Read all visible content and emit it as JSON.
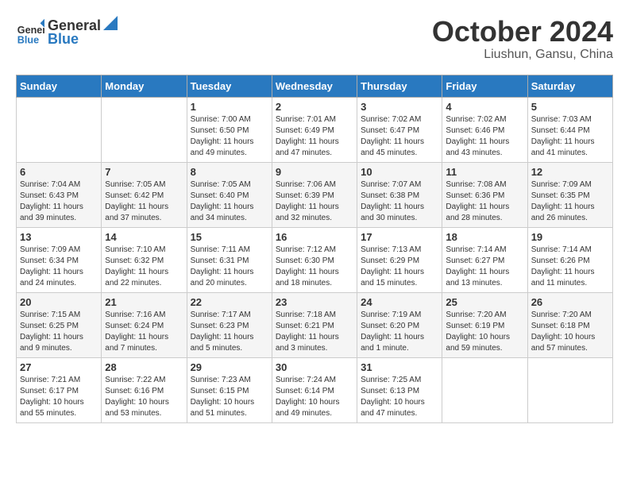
{
  "header": {
    "logo_line1": "General",
    "logo_line2": "Blue",
    "month": "October 2024",
    "location": "Liushun, Gansu, China"
  },
  "days_of_week": [
    "Sunday",
    "Monday",
    "Tuesday",
    "Wednesday",
    "Thursday",
    "Friday",
    "Saturday"
  ],
  "weeks": [
    [
      {
        "day": "",
        "data": ""
      },
      {
        "day": "",
        "data": ""
      },
      {
        "day": "1",
        "data": "Sunrise: 7:00 AM\nSunset: 6:50 PM\nDaylight: 11 hours and 49 minutes."
      },
      {
        "day": "2",
        "data": "Sunrise: 7:01 AM\nSunset: 6:49 PM\nDaylight: 11 hours and 47 minutes."
      },
      {
        "day": "3",
        "data": "Sunrise: 7:02 AM\nSunset: 6:47 PM\nDaylight: 11 hours and 45 minutes."
      },
      {
        "day": "4",
        "data": "Sunrise: 7:02 AM\nSunset: 6:46 PM\nDaylight: 11 hours and 43 minutes."
      },
      {
        "day": "5",
        "data": "Sunrise: 7:03 AM\nSunset: 6:44 PM\nDaylight: 11 hours and 41 minutes."
      }
    ],
    [
      {
        "day": "6",
        "data": "Sunrise: 7:04 AM\nSunset: 6:43 PM\nDaylight: 11 hours and 39 minutes."
      },
      {
        "day": "7",
        "data": "Sunrise: 7:05 AM\nSunset: 6:42 PM\nDaylight: 11 hours and 37 minutes."
      },
      {
        "day": "8",
        "data": "Sunrise: 7:05 AM\nSunset: 6:40 PM\nDaylight: 11 hours and 34 minutes."
      },
      {
        "day": "9",
        "data": "Sunrise: 7:06 AM\nSunset: 6:39 PM\nDaylight: 11 hours and 32 minutes."
      },
      {
        "day": "10",
        "data": "Sunrise: 7:07 AM\nSunset: 6:38 PM\nDaylight: 11 hours and 30 minutes."
      },
      {
        "day": "11",
        "data": "Sunrise: 7:08 AM\nSunset: 6:36 PM\nDaylight: 11 hours and 28 minutes."
      },
      {
        "day": "12",
        "data": "Sunrise: 7:09 AM\nSunset: 6:35 PM\nDaylight: 11 hours and 26 minutes."
      }
    ],
    [
      {
        "day": "13",
        "data": "Sunrise: 7:09 AM\nSunset: 6:34 PM\nDaylight: 11 hours and 24 minutes."
      },
      {
        "day": "14",
        "data": "Sunrise: 7:10 AM\nSunset: 6:32 PM\nDaylight: 11 hours and 22 minutes."
      },
      {
        "day": "15",
        "data": "Sunrise: 7:11 AM\nSunset: 6:31 PM\nDaylight: 11 hours and 20 minutes."
      },
      {
        "day": "16",
        "data": "Sunrise: 7:12 AM\nSunset: 6:30 PM\nDaylight: 11 hours and 18 minutes."
      },
      {
        "day": "17",
        "data": "Sunrise: 7:13 AM\nSunset: 6:29 PM\nDaylight: 11 hours and 15 minutes."
      },
      {
        "day": "18",
        "data": "Sunrise: 7:14 AM\nSunset: 6:27 PM\nDaylight: 11 hours and 13 minutes."
      },
      {
        "day": "19",
        "data": "Sunrise: 7:14 AM\nSunset: 6:26 PM\nDaylight: 11 hours and 11 minutes."
      }
    ],
    [
      {
        "day": "20",
        "data": "Sunrise: 7:15 AM\nSunset: 6:25 PM\nDaylight: 11 hours and 9 minutes."
      },
      {
        "day": "21",
        "data": "Sunrise: 7:16 AM\nSunset: 6:24 PM\nDaylight: 11 hours and 7 minutes."
      },
      {
        "day": "22",
        "data": "Sunrise: 7:17 AM\nSunset: 6:23 PM\nDaylight: 11 hours and 5 minutes."
      },
      {
        "day": "23",
        "data": "Sunrise: 7:18 AM\nSunset: 6:21 PM\nDaylight: 11 hours and 3 minutes."
      },
      {
        "day": "24",
        "data": "Sunrise: 7:19 AM\nSunset: 6:20 PM\nDaylight: 11 hours and 1 minute."
      },
      {
        "day": "25",
        "data": "Sunrise: 7:20 AM\nSunset: 6:19 PM\nDaylight: 10 hours and 59 minutes."
      },
      {
        "day": "26",
        "data": "Sunrise: 7:20 AM\nSunset: 6:18 PM\nDaylight: 10 hours and 57 minutes."
      }
    ],
    [
      {
        "day": "27",
        "data": "Sunrise: 7:21 AM\nSunset: 6:17 PM\nDaylight: 10 hours and 55 minutes."
      },
      {
        "day": "28",
        "data": "Sunrise: 7:22 AM\nSunset: 6:16 PM\nDaylight: 10 hours and 53 minutes."
      },
      {
        "day": "29",
        "data": "Sunrise: 7:23 AM\nSunset: 6:15 PM\nDaylight: 10 hours and 51 minutes."
      },
      {
        "day": "30",
        "data": "Sunrise: 7:24 AM\nSunset: 6:14 PM\nDaylight: 10 hours and 49 minutes."
      },
      {
        "day": "31",
        "data": "Sunrise: 7:25 AM\nSunset: 6:13 PM\nDaylight: 10 hours and 47 minutes."
      },
      {
        "day": "",
        "data": ""
      },
      {
        "day": "",
        "data": ""
      }
    ]
  ]
}
